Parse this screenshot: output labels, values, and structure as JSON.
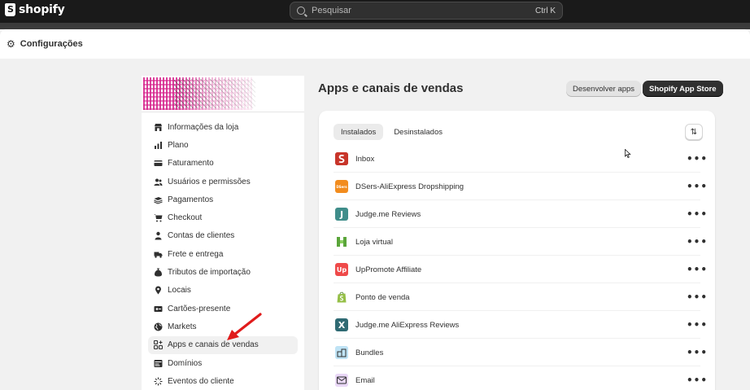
{
  "topbar": {
    "brand": "shopify",
    "search_placeholder": "Pesquisar",
    "shortcut": "Ctrl K"
  },
  "settings": {
    "title": "Configurações"
  },
  "sidebar": {
    "items": [
      {
        "label": "Informações da loja",
        "icon": "store-icon"
      },
      {
        "label": "Plano",
        "icon": "plan-icon"
      },
      {
        "label": "Faturamento",
        "icon": "billing-icon"
      },
      {
        "label": "Usuários e permissões",
        "icon": "users-icon"
      },
      {
        "label": "Pagamentos",
        "icon": "payments-icon"
      },
      {
        "label": "Checkout",
        "icon": "cart-icon"
      },
      {
        "label": "Contas de clientes",
        "icon": "person-icon"
      },
      {
        "label": "Frete e entrega",
        "icon": "truck-icon"
      },
      {
        "label": "Tributos de importação",
        "icon": "tax-icon"
      },
      {
        "label": "Locais",
        "icon": "location-icon"
      },
      {
        "label": "Cartões-presente",
        "icon": "gift-card-icon"
      },
      {
        "label": "Markets",
        "icon": "globe-icon"
      },
      {
        "label": "Apps e canais de vendas",
        "icon": "apps-icon",
        "active": true
      },
      {
        "label": "Domínios",
        "icon": "domains-icon"
      },
      {
        "label": "Eventos do cliente",
        "icon": "events-icon"
      }
    ]
  },
  "main": {
    "title": "Apps e canais de vendas",
    "develop_button": "Desenvolver apps",
    "store_button": "Shopify App Store",
    "tabs": [
      {
        "label": "Instalados",
        "active": true
      },
      {
        "label": "Desinstalados",
        "active": false
      }
    ],
    "apps": [
      {
        "name": "Inbox",
        "icon_color": "#d8432e",
        "icon_glyph": "S"
      },
      {
        "name": "DSers-AliExpress Dropshipping",
        "icon_color": "#f28c1e",
        "icon_glyph": "D"
      },
      {
        "name": "Judge.me Reviews",
        "icon_color": "#3f8d8a",
        "icon_glyph": "J"
      },
      {
        "name": "Loja virtual",
        "icon_color": "#6fb744",
        "icon_glyph": "H"
      },
      {
        "name": "UpPromote Affiliate",
        "icon_color": "#ef4a4a",
        "icon_glyph": "U"
      },
      {
        "name": "Ponto de venda",
        "icon_color": "#ffffff",
        "icon_glyph": "P"
      },
      {
        "name": "Judge.me AliExpress Reviews",
        "icon_color": "#2f6a73",
        "icon_glyph": "X"
      },
      {
        "name": "Bundles",
        "icon_color": "#bfe3f5",
        "icon_glyph": "B"
      },
      {
        "name": "Email",
        "icon_color": "#e9d7f6",
        "icon_glyph": "E"
      }
    ]
  }
}
